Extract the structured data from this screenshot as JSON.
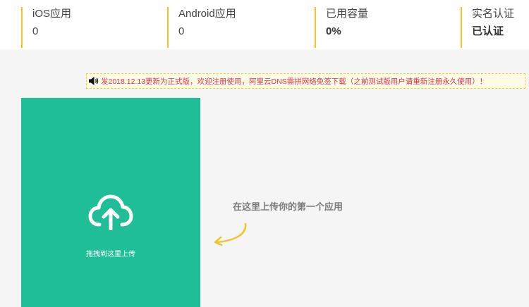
{
  "stats": [
    {
      "label": "iOS应用",
      "value": "0"
    },
    {
      "label": "Android应用",
      "value": "0"
    },
    {
      "label": "已用容量",
      "value": "0%"
    },
    {
      "label": "实名认证",
      "value": "已认证"
    }
  ],
  "notice": {
    "icon": "speaker-icon",
    "text": "发2018.12.13更新为正式版，欢迎注册使用，阿里云DNS需拼网络免签下载（之前测试版用户请重新注册永久使用）！"
  },
  "upload": {
    "icon": "cloud-upload-icon",
    "label": "拖拽到这里上传"
  },
  "hint": {
    "text": "在这里上传你的第一个应用"
  },
  "colors": {
    "accent": "#f0c52a",
    "upload_bg": "#1fbe96",
    "notice_text": "#e0314f",
    "arrow": "#f0c52a"
  }
}
